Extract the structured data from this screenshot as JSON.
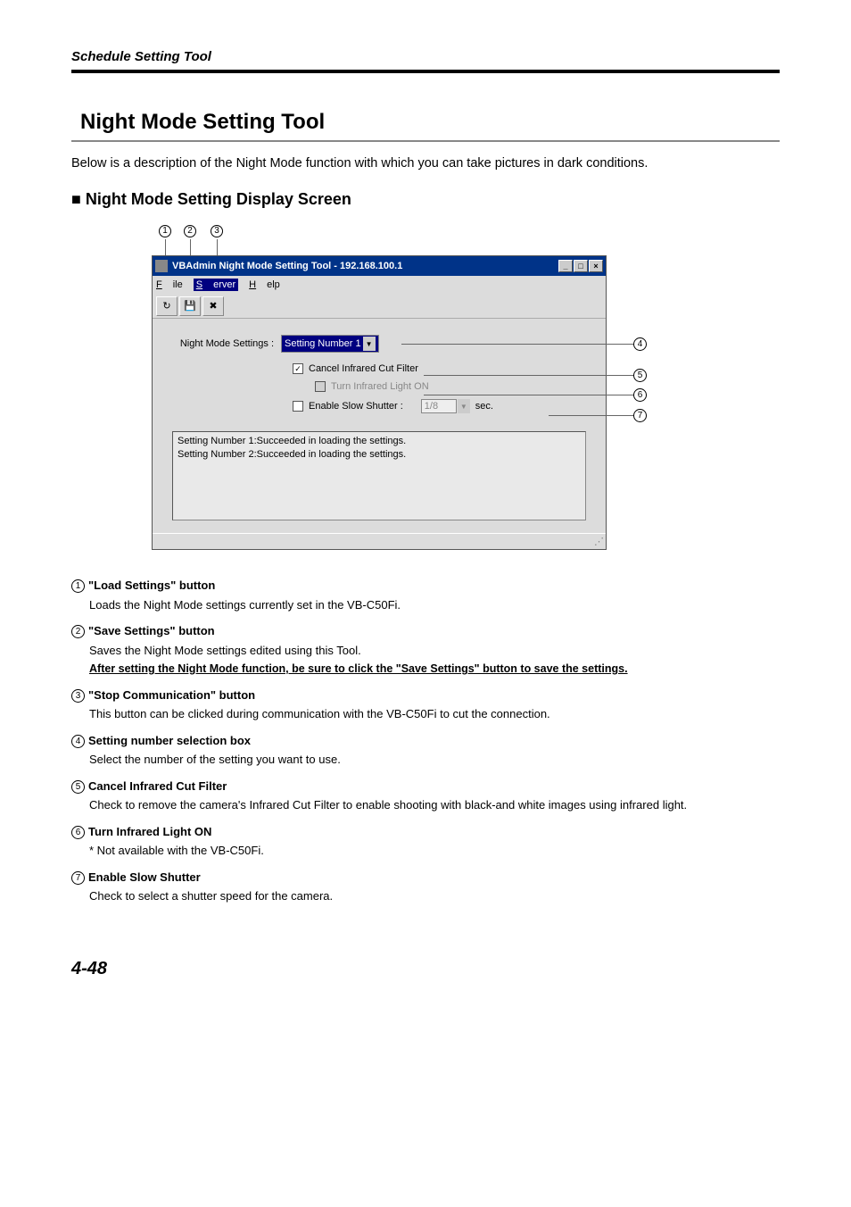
{
  "header": {
    "section": "Schedule Setting Tool"
  },
  "title": "Night Mode Setting Tool",
  "intro": "Below is a description of the Night Mode function with which you can take pictures in dark conditions.",
  "subtitle": "Night Mode Setting Display Screen",
  "window": {
    "title": "VBAdmin Night Mode Setting Tool - 192.168.100.1",
    "menu": {
      "file": "File",
      "server": "Server",
      "help": "Help"
    },
    "settings_label": "Night Mode Settings :",
    "settings_value": "Setting Number 1",
    "cancel_ir_label": "Cancel Infrared Cut Filter",
    "turn_ir_label": "Turn Infrared Light ON",
    "slow_shutter_label": "Enable Slow Shutter :",
    "slow_shutter_value": "1/8",
    "slow_shutter_unit": "sec.",
    "log": [
      "Setting Number 1:Succeeded in loading the settings.",
      "Setting Number 2:Succeeded in loading the settings."
    ]
  },
  "descriptions": [
    {
      "num": "1",
      "title": "\"Load Settings\" button",
      "body": "Loads the Night Mode settings currently set in the VB-C50Fi."
    },
    {
      "num": "2",
      "title": "\"Save Settings\" button",
      "body": "Saves the Night Mode settings edited using this Tool.",
      "extra": "After setting the Night Mode function, be sure to click the \"Save Settings\" button to save the settings."
    },
    {
      "num": "3",
      "title": "\"Stop Communication\" button",
      "body": "This button can be clicked during communication with the VB-C50Fi to cut the connection."
    },
    {
      "num": "4",
      "title": "Setting number selection box",
      "body": "Select the number of the setting you want to use."
    },
    {
      "num": "5",
      "title": "Cancel Infrared Cut Filter",
      "body": "Check to remove the camera's Infrared Cut Filter to enable shooting with black-and white images using infrared light."
    },
    {
      "num": "6",
      "title": "Turn Infrared Light ON",
      "body": "* Not available with the VB-C50Fi."
    },
    {
      "num": "7",
      "title": "Enable Slow Shutter",
      "body": "Check to select a shutter speed for the camera."
    }
  ],
  "pagenum": "4-48",
  "markers": {
    "m1": "1",
    "m2": "2",
    "m3": "3",
    "m4": "4",
    "m5": "5",
    "m6": "6",
    "m7": "7"
  }
}
